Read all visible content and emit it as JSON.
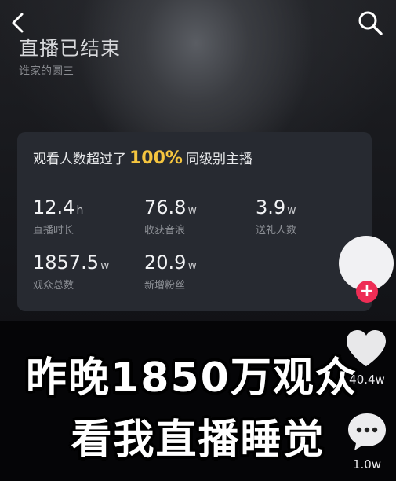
{
  "header": {
    "back_icon": "chevron-left-icon",
    "search_icon": "search-icon",
    "title": "直播已结束",
    "streamer_name": "谁家的圆三"
  },
  "stats_card": {
    "headline_prefix": "观看人数超过了",
    "headline_percent": "100%",
    "headline_suffix": "同级别主播",
    "stats": [
      {
        "value": "12.4",
        "unit": "h",
        "label": "直播时长"
      },
      {
        "value": "76.8",
        "unit": "w",
        "label": "收获音浪"
      },
      {
        "value": "3.9",
        "unit": "w",
        "label": "送礼人数"
      },
      {
        "value": "1857.5",
        "unit": "w",
        "label": "观众总数"
      },
      {
        "value": "20.9",
        "unit": "w",
        "label": "新增粉丝"
      }
    ]
  },
  "caption": {
    "line1": "昨晚1850万观众",
    "line2": "看我直播睡觉"
  },
  "side_actions": {
    "follow_symbol": "+",
    "like_count": "40.4w",
    "comment_count": "1.0w",
    "colors": {
      "follow": "#ee2d55",
      "highlight": "#f5c53f"
    }
  }
}
